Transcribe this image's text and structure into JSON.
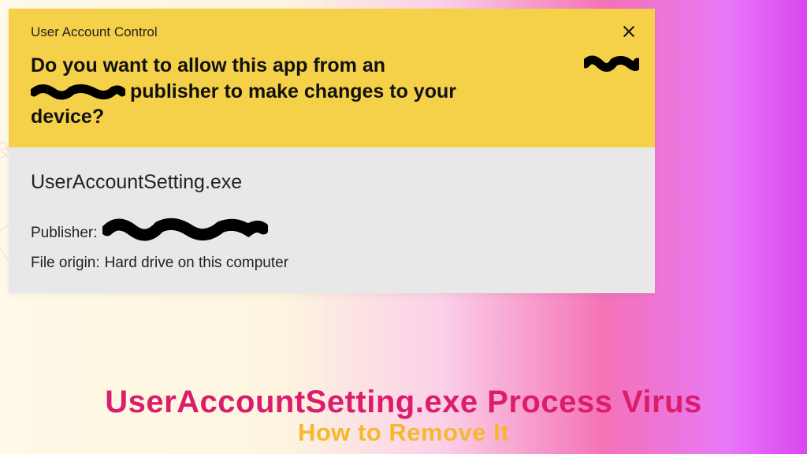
{
  "dialog": {
    "title": "User Account Control",
    "question_line1": "Do you want to allow this app from an",
    "question_line2_suffix": "publisher to make changes to your",
    "question_line3": "device?"
  },
  "body": {
    "exe_name": "UserAccountSetting.exe",
    "publisher_label": "Publisher:",
    "origin_label": "File origin:",
    "origin_value": "Hard drive on this computer"
  },
  "caption": {
    "title": "UserAccountSetting.exe Process Virus",
    "subtitle": "How to Remove It"
  }
}
